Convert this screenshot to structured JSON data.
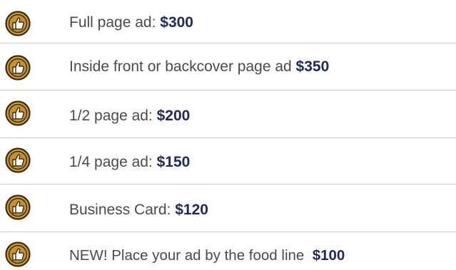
{
  "items": [
    {
      "icon": "thumbs-up-badge-icon",
      "text": "Full page ad: ",
      "price": "$300"
    },
    {
      "icon": "thumbs-up-badge-icon",
      "text": "Inside front or backcover page ad ",
      "price": "$350"
    },
    {
      "icon": "thumbs-up-badge-icon",
      "text": " 1/2 page ad: ",
      "price": "$200"
    },
    {
      "icon": "thumbs-up-badge-icon",
      "text": "1/4 page ad: ",
      "price": "$150"
    },
    {
      "icon": "thumbs-up-badge-icon",
      "text": "Business Card: ",
      "price": "$120"
    },
    {
      "icon": "thumbs-up-badge-icon",
      "text": "NEW! Place your ad by the food line  ",
      "price": "$100"
    }
  ],
  "colors": {
    "badge_fill": "#d3a02b",
    "badge_outline": "#3b2a12",
    "text": "#4a4a4a",
    "price": "#1f2a5c",
    "separator": "#cccccc"
  }
}
